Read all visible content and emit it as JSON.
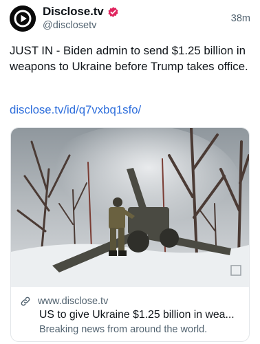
{
  "author": {
    "display_name": "Disclose.tv",
    "handle": "@disclosetv",
    "avatar_icon": "play-logo-icon",
    "badge_icon": "verified-badge-icon",
    "badge_color": "#e0245e"
  },
  "post": {
    "timestamp": "38m",
    "text": "JUST IN - Biden admin to send $1.25 billion in weapons to Ukraine before Trump takes office.",
    "link": "disclose.tv/id/q7vxbq1sfo/",
    "link_color": "#2f6fdc"
  },
  "card": {
    "image_icon": "artillery-photo",
    "link_icon": "link-icon",
    "domain": "www.disclose.tv",
    "title": "US to give Ukraine $1.25 billion in wea...",
    "description": "Breaking news from around the world."
  }
}
